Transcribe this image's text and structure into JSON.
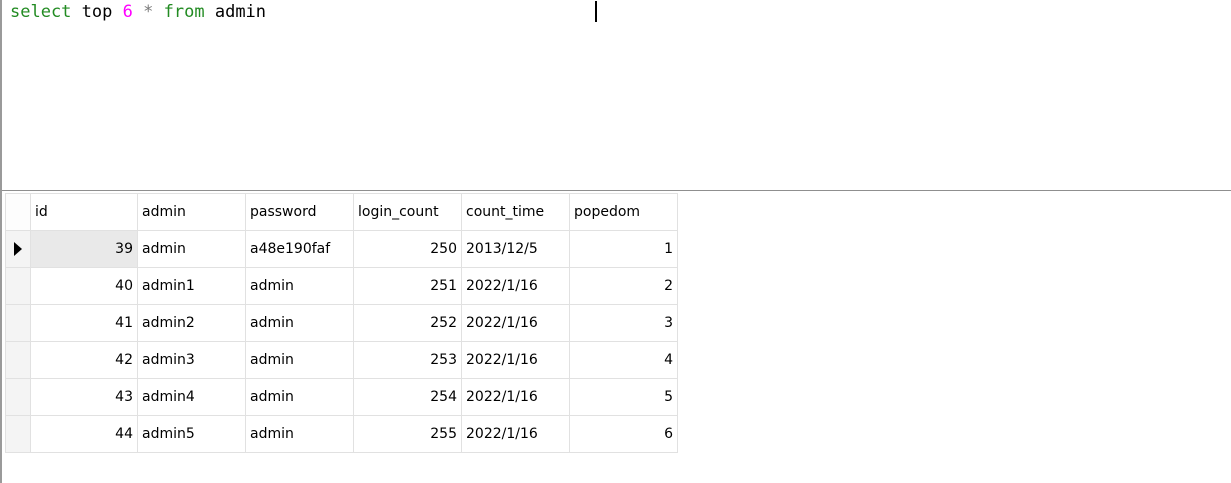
{
  "editor": {
    "sql": {
      "select": "select",
      "top": "top",
      "count": "6",
      "star": "*",
      "from": "from",
      "table": "admin"
    }
  },
  "grid": {
    "columns": [
      "id",
      "admin",
      "password",
      "login_count",
      "count_time",
      "popedom"
    ],
    "rows": [
      {
        "id": "39",
        "admin": "admin",
        "password": "a48e190faf",
        "login_count": "250",
        "count_time": "2013/12/5",
        "popedom": "1"
      },
      {
        "id": "40",
        "admin": "admin1",
        "password": "admin",
        "login_count": "251",
        "count_time": "2022/1/16",
        "popedom": "2"
      },
      {
        "id": "41",
        "admin": "admin2",
        "password": "admin",
        "login_count": "252",
        "count_time": "2022/1/16",
        "popedom": "3"
      },
      {
        "id": "42",
        "admin": "admin3",
        "password": "admin",
        "login_count": "253",
        "count_time": "2022/1/16",
        "popedom": "4"
      },
      {
        "id": "43",
        "admin": "admin4",
        "password": "admin",
        "login_count": "254",
        "count_time": "2022/1/16",
        "popedom": "5"
      },
      {
        "id": "44",
        "admin": "admin5",
        "password": "admin",
        "login_count": "255",
        "count_time": "2022/1/16",
        "popedom": "6"
      }
    ],
    "current_row_icon": "row-pointer-icon"
  },
  "colors": {
    "keyword": "#228b22",
    "number": "#ff00ff",
    "operator": "#7a7a7a"
  }
}
